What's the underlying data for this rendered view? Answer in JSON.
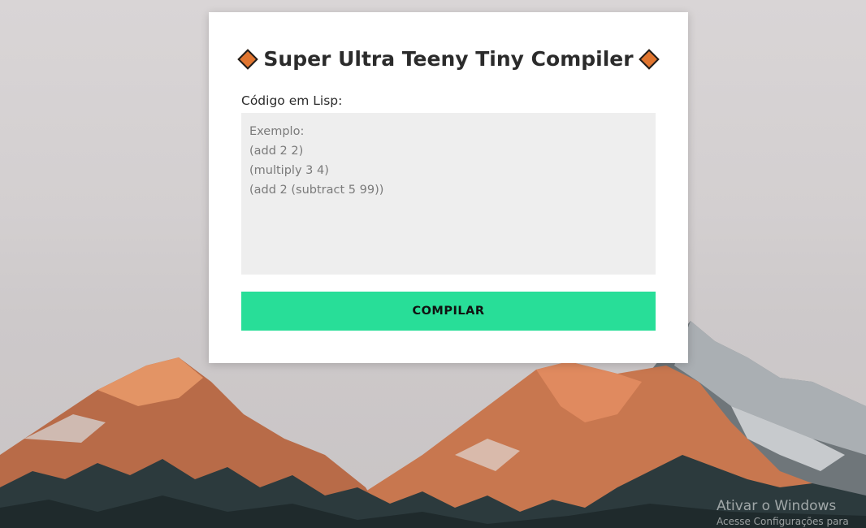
{
  "app": {
    "title": "Super Ultra Teeny Tiny Compiler"
  },
  "form": {
    "label": "Código em Lisp:",
    "placeholder": "Exemplo:\n(add 2 2)\n(multiply 3 4)\n(add 2 (subtract 5 99))",
    "button_label": "COMPILAR"
  },
  "os_watermark": {
    "title": "Ativar o Windows",
    "subtitle": "Acesse Configurações para"
  },
  "colors": {
    "accent": "#28de98",
    "diamond": "#e0752f",
    "textarea_bg": "#eeeeee"
  },
  "icons": {
    "title_left": "orange-diamond-icon",
    "title_right": "orange-diamond-icon"
  }
}
